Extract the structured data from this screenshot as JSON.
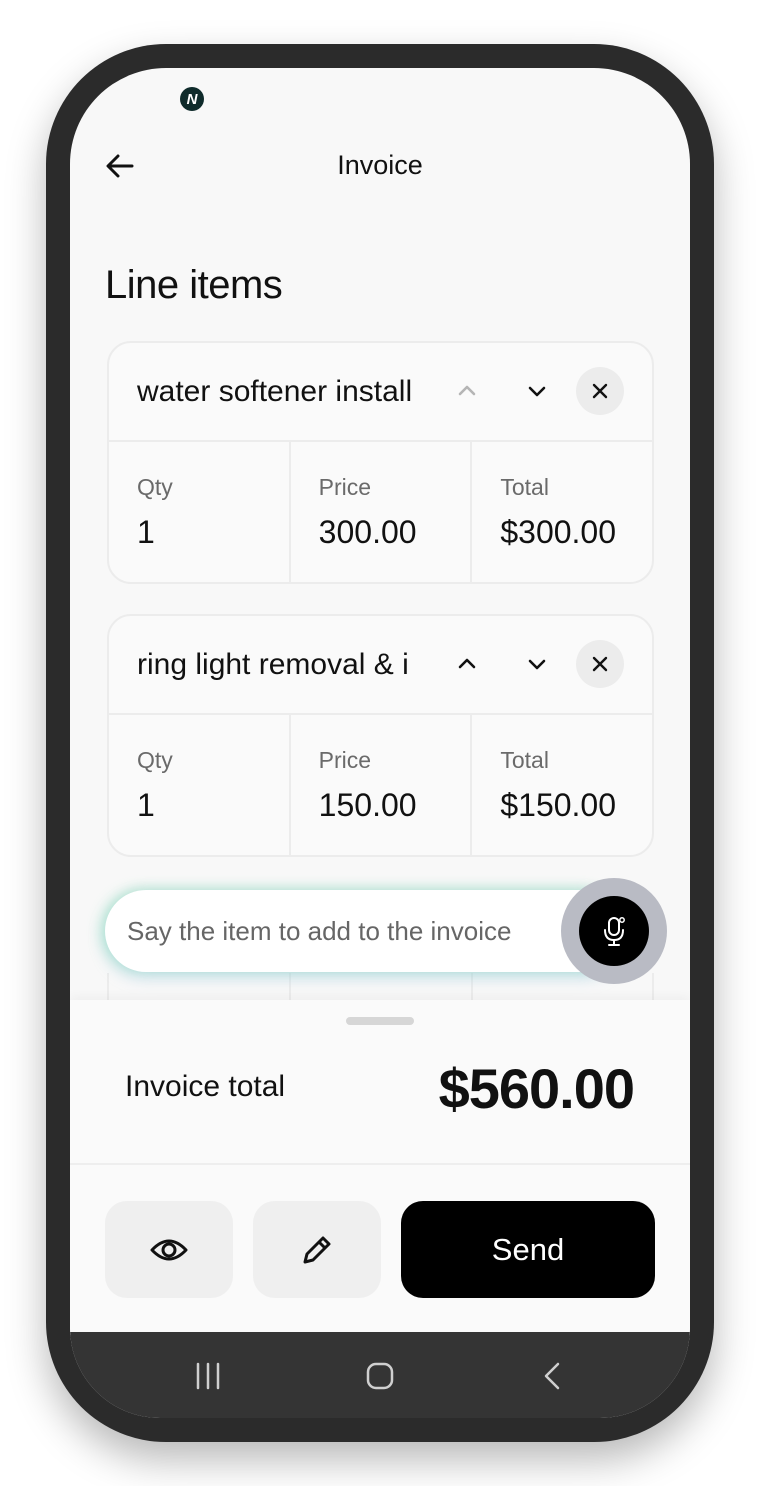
{
  "status": {
    "logo_icon": "n-logo-icon",
    "logo_glyph": "N"
  },
  "header": {
    "title": "Invoice",
    "back_icon": "arrow-left-icon"
  },
  "section": {
    "title": "Line items"
  },
  "line_items": [
    {
      "name": "water softener install",
      "qty_label": "Qty",
      "qty": "1",
      "price_label": "Price",
      "price": "300.00",
      "total_label": "Total",
      "total": "$300.00"
    },
    {
      "name": "ring light removal & i",
      "qty_label": "Qty",
      "qty": "1",
      "price_label": "Price",
      "price": "150.00",
      "total_label": "Total",
      "total": "$150.00"
    }
  ],
  "voice_input": {
    "placeholder": "Say the item to add to the invoice",
    "icon": "microphone-icon"
  },
  "summary": {
    "label": "Invoice total",
    "value": "$560.00"
  },
  "actions": {
    "preview_icon": "eye-icon",
    "edit_icon": "pencil-icon",
    "send_label": "Send"
  },
  "system_nav": {
    "recents_icon": "recents-icon",
    "home_icon": "home-icon",
    "back_icon": "chevron-left-icon"
  },
  "colors": {
    "primary": "#000000",
    "background": "#f8f8f8",
    "card_border": "#ececec",
    "mic_ring": "#b9bbc4"
  }
}
